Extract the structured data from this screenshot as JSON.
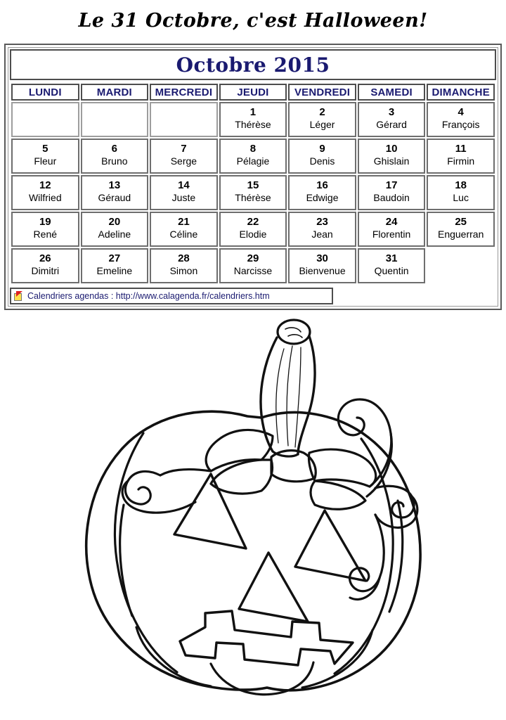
{
  "page": {
    "title": "Le 31 Octobre, c'est Halloween!"
  },
  "calendar": {
    "month_title": "Octobre 2015",
    "weekday_headers": [
      "LUNDI",
      "MARDI",
      "MERCREDI",
      "JEUDI",
      "VENDREDI",
      "SAMEDI",
      "DIMANCHE"
    ],
    "colors": {
      "header_text": "#1a1a70",
      "day_number": "#000000",
      "saint_name": "#000000",
      "border": "#4d4d4d",
      "footer_link": "#1a1a70"
    },
    "weeks": [
      [
        {
          "day": "",
          "saint": ""
        },
        {
          "day": "",
          "saint": ""
        },
        {
          "day": "",
          "saint": ""
        },
        {
          "day": "1",
          "saint": "Thérèse"
        },
        {
          "day": "2",
          "saint": "Léger"
        },
        {
          "day": "3",
          "saint": "Gérard"
        },
        {
          "day": "4",
          "saint": "François"
        }
      ],
      [
        {
          "day": "5",
          "saint": "Fleur"
        },
        {
          "day": "6",
          "saint": "Bruno"
        },
        {
          "day": "7",
          "saint": "Serge"
        },
        {
          "day": "8",
          "saint": "Pélagie"
        },
        {
          "day": "9",
          "saint": "Denis"
        },
        {
          "day": "10",
          "saint": "Ghislain"
        },
        {
          "day": "11",
          "saint": "Firmin"
        }
      ],
      [
        {
          "day": "12",
          "saint": "Wilfried"
        },
        {
          "day": "13",
          "saint": "Géraud"
        },
        {
          "day": "14",
          "saint": "Juste"
        },
        {
          "day": "15",
          "saint": "Thérèse"
        },
        {
          "day": "16",
          "saint": "Edwige"
        },
        {
          "day": "17",
          "saint": "Baudoin"
        },
        {
          "day": "18",
          "saint": "Luc"
        }
      ],
      [
        {
          "day": "19",
          "saint": "René"
        },
        {
          "day": "20",
          "saint": "Adeline"
        },
        {
          "day": "21",
          "saint": "Céline"
        },
        {
          "day": "22",
          "saint": "Elodie"
        },
        {
          "day": "23",
          "saint": "Jean"
        },
        {
          "day": "24",
          "saint": "Florentin"
        },
        {
          "day": "25",
          "saint": "Enguerran"
        }
      ],
      [
        {
          "day": "26",
          "saint": "Dimitri"
        },
        {
          "day": "27",
          "saint": "Emeline"
        },
        {
          "day": "28",
          "saint": "Simon"
        },
        {
          "day": "29",
          "saint": "Narcisse"
        },
        {
          "day": "30",
          "saint": "Bienvenue"
        },
        {
          "day": "31",
          "saint": "Quentin"
        },
        {
          "day": "",
          "saint": ""
        }
      ]
    ],
    "footer": {
      "icon": "calagenda-flag-icon",
      "text": "Calendriers agendas : http://www.calagenda.fr/calendriers.htm"
    }
  },
  "illustration": {
    "name": "jack-o-lantern-coloring-drawing",
    "description": "Black line-art jack-o-lantern with curved stem, leaves, spiral tendrils, two triangular eyes, triangular nose and zigzag toothy mouth"
  }
}
